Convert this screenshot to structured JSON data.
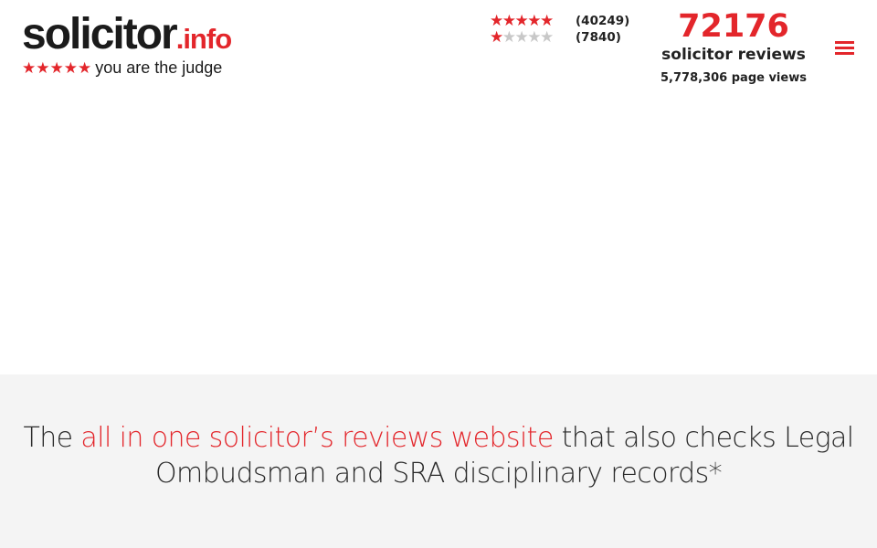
{
  "logo": {
    "main": "solicitor",
    "suffix": ".info",
    "stars": "★★★★★",
    "subtitle": "you are the judge"
  },
  "ratings": [
    {
      "stars_filled": 5,
      "stars_total": 5,
      "count": "(40249)"
    },
    {
      "stars_filled": 1,
      "stars_total": 5,
      "count": "(7840)"
    }
  ],
  "stats": {
    "review_count": "72176",
    "review_label": "solicitor reviews",
    "page_views": "5,778,306 page views"
  },
  "menu": {
    "icon": "hamburger-menu-icon"
  },
  "hero": {
    "tagline_before": "The ",
    "tagline_highlight": "all in one solicitor’s reviews website",
    "tagline_after": " that also checks Legal Ombudsman and SRA disciplinary records*"
  },
  "colors": {
    "accent": "#e3262b",
    "text": "#222222",
    "hero_background": "#f4f4f4",
    "star_off": "#c8c8c8"
  }
}
